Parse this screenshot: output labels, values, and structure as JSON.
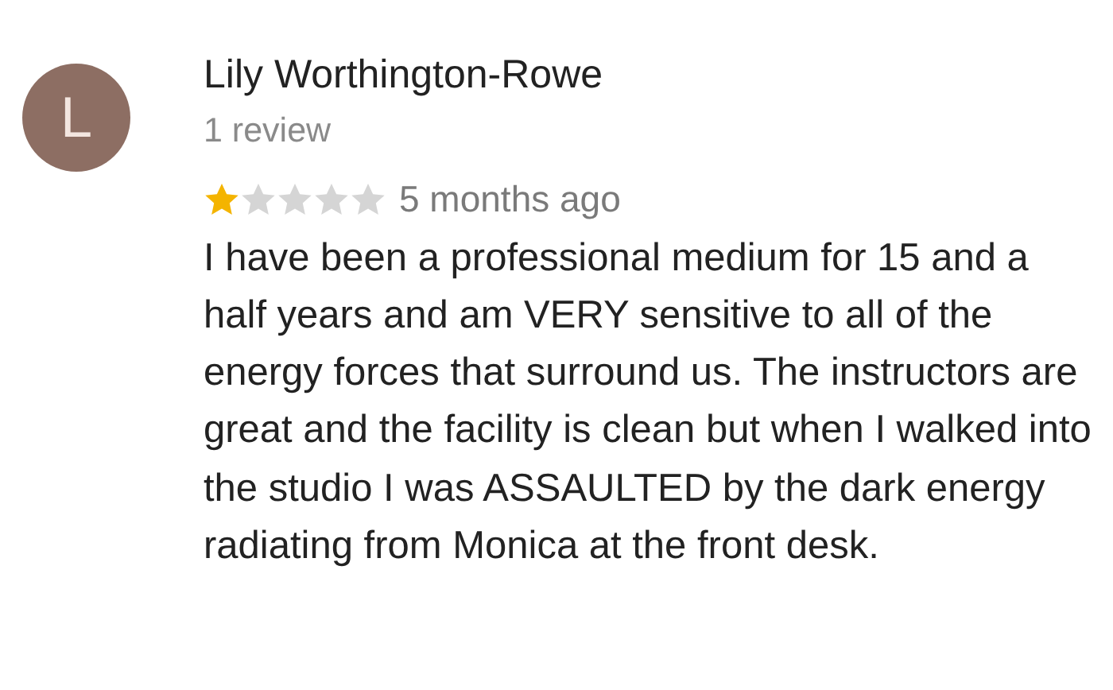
{
  "review": {
    "avatar_letter": "L",
    "author": "Lily Worthington-Rowe",
    "author_reviews": "1 review",
    "stars": 1,
    "time": "5 months ago",
    "text": "I have been a professional medium for 15 and a half years and am VERY sensitive to all of the energy forces that surround us. The instructors are great and the facility is clean but when I walked into the studio I was ASSAULTED by the dark energy radiating from Monica at the front desk."
  }
}
